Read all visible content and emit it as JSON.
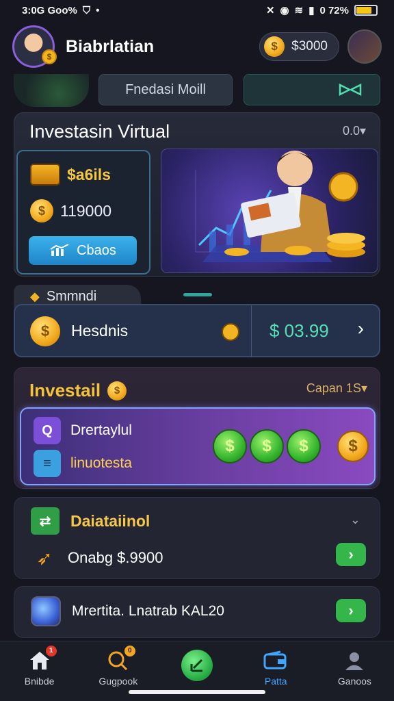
{
  "status_bar": {
    "left_text": "3:0G Goo%",
    "battery_percent": "0 72%",
    "icons": [
      "shield-icon",
      "dot-icon",
      "nfc-icon",
      "alarm-icon",
      "wifi-icon",
      "signal-icon",
      "battery-icon"
    ]
  },
  "header": {
    "username": "Biabrlatian",
    "balance": "$3000",
    "coin_symbol": "$"
  },
  "tabs": {
    "center_label": "Fnedasi Moill",
    "right_icon": "bow-tie-icon"
  },
  "virtual_card": {
    "title": "Investasin Virtual",
    "meta": "0.0▾",
    "wallet_label": "$a6ils",
    "coin_amount": "119000",
    "button_label": "Cbaos",
    "coin_symbol": "$"
  },
  "select_section": {
    "tab_label": "Smmndi",
    "item_name": "Hesdnis",
    "price": "$ 03.99",
    "coin_symbol": "$"
  },
  "invest_card": {
    "title": "Investail",
    "meta": "Capan 1S▾",
    "row1_label": "Drertaylul",
    "row2_label": "linuotesta",
    "coins": [
      "$",
      "$",
      "$"
    ],
    "gold_coin": "$"
  },
  "digital_card": {
    "title": "Daiataiinol",
    "row_text": "Onabg $.9900"
  },
  "market_card": {
    "text": "Mrertita. Lnatrab KAL20"
  },
  "bottom_nav": {
    "items": [
      {
        "label": "Bnibde",
        "icon": "home-icon",
        "badge": "1"
      },
      {
        "label": "Gugpook",
        "icon": "search-icon",
        "badge": "0"
      },
      {
        "label": "",
        "icon": "chart-icon"
      },
      {
        "label": "Patta",
        "icon": "wallet-icon"
      },
      {
        "label": "Ganoos",
        "icon": "user-icon"
      }
    ]
  },
  "colors": {
    "background": "#15161f",
    "accent_gold": "#f5c33a",
    "accent_teal": "#55e0b8",
    "accent_blue": "#3fa5ff",
    "accent_green": "#35b64a"
  }
}
